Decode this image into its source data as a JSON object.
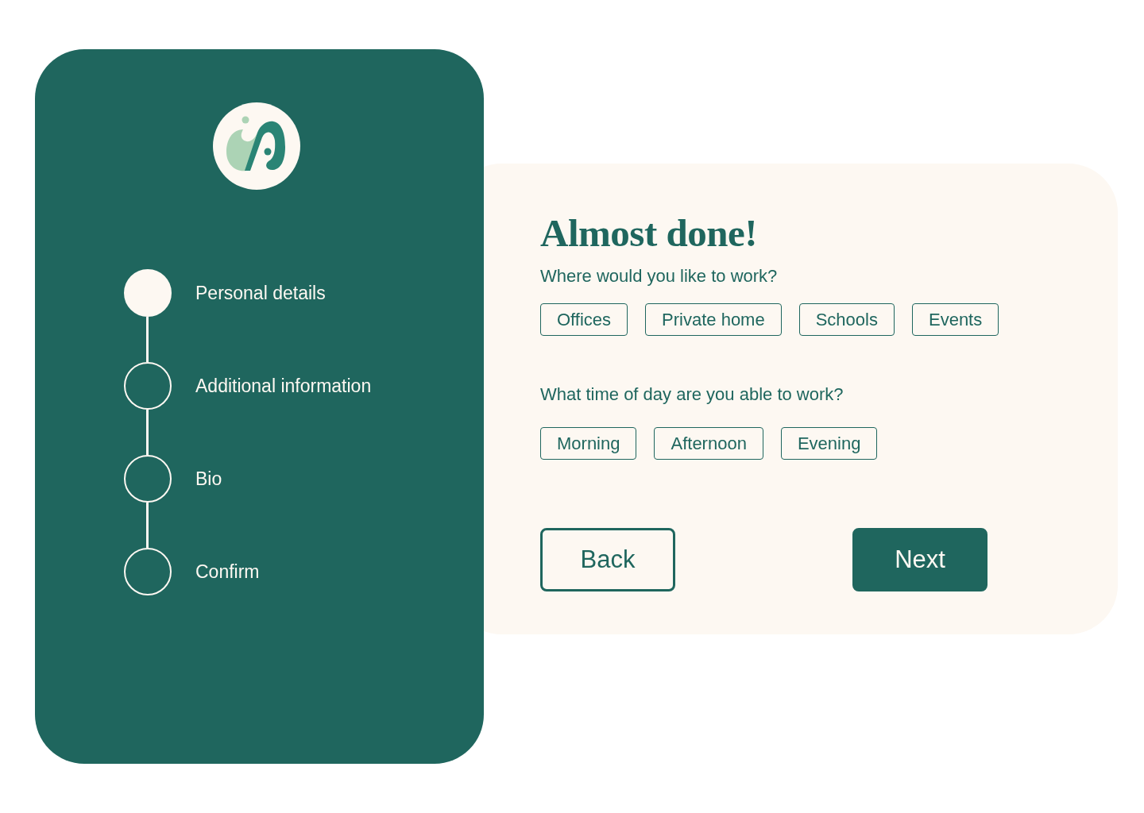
{
  "sidebar": {
    "steps": [
      {
        "label": "Personal details",
        "active": true
      },
      {
        "label": "Additional information",
        "active": false
      },
      {
        "label": "Bio",
        "active": false
      },
      {
        "label": "Confirm",
        "active": false
      }
    ]
  },
  "form": {
    "title": "Almost done!",
    "questions": [
      {
        "prompt": "Where would you like to work?",
        "options": [
          {
            "label": "Offices",
            "selected": false
          },
          {
            "label": "Private home",
            "selected": false
          },
          {
            "label": "Schools",
            "selected": false
          },
          {
            "label": "Events",
            "selected": false
          }
        ]
      },
      {
        "prompt": "What time of day are you able to work?",
        "options": [
          {
            "label": "Morning",
            "selected": false
          },
          {
            "label": "Afternoon",
            "selected": false
          },
          {
            "label": "Evening",
            "selected": false
          }
        ]
      }
    ],
    "buttons": [
      {
        "label": "Back",
        "kind": "secondary"
      },
      {
        "label": "Next",
        "kind": "primary"
      }
    ]
  }
}
